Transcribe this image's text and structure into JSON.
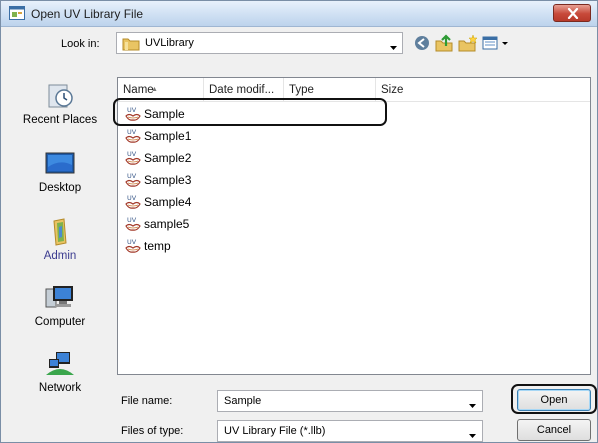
{
  "window": {
    "title": "Open UV Library File"
  },
  "lookin": {
    "label": "Look in:",
    "value": "UVLibrary"
  },
  "toolbar": {
    "back_icon": "back-arrow-icon",
    "up_icon": "up-folder-icon",
    "new_folder_icon": "new-folder-icon",
    "views_icon": "views-menu-icon"
  },
  "places": [
    {
      "label": "Recent Places",
      "icon": "recent-places-icon"
    },
    {
      "label": "Desktop",
      "icon": "desktop-icon"
    },
    {
      "label": "Admin",
      "icon": "user-folder-icon"
    },
    {
      "label": "Computer",
      "icon": "computer-icon"
    },
    {
      "label": "Network",
      "icon": "network-icon"
    }
  ],
  "columns": {
    "name": "Name",
    "date": "Date modif...",
    "type": "Type",
    "size": "Size"
  },
  "files": [
    {
      "name": "Sample",
      "selected": true
    },
    {
      "name": "Sample1"
    },
    {
      "name": "Sample2"
    },
    {
      "name": "Sample3"
    },
    {
      "name": "Sample4"
    },
    {
      "name": "sample5"
    },
    {
      "name": "temp"
    }
  ],
  "file_icon_text": "UV",
  "filename": {
    "label": "File name:",
    "value": "Sample"
  },
  "filetype": {
    "label": "Files of type:",
    "value": "UV Library File (*.llb)"
  },
  "buttons": {
    "open": "Open",
    "cancel": "Cancel"
  },
  "colors": {
    "accent": "#3c7fb1",
    "close": "#c7493a",
    "titlebar": "#cfe0f3"
  }
}
